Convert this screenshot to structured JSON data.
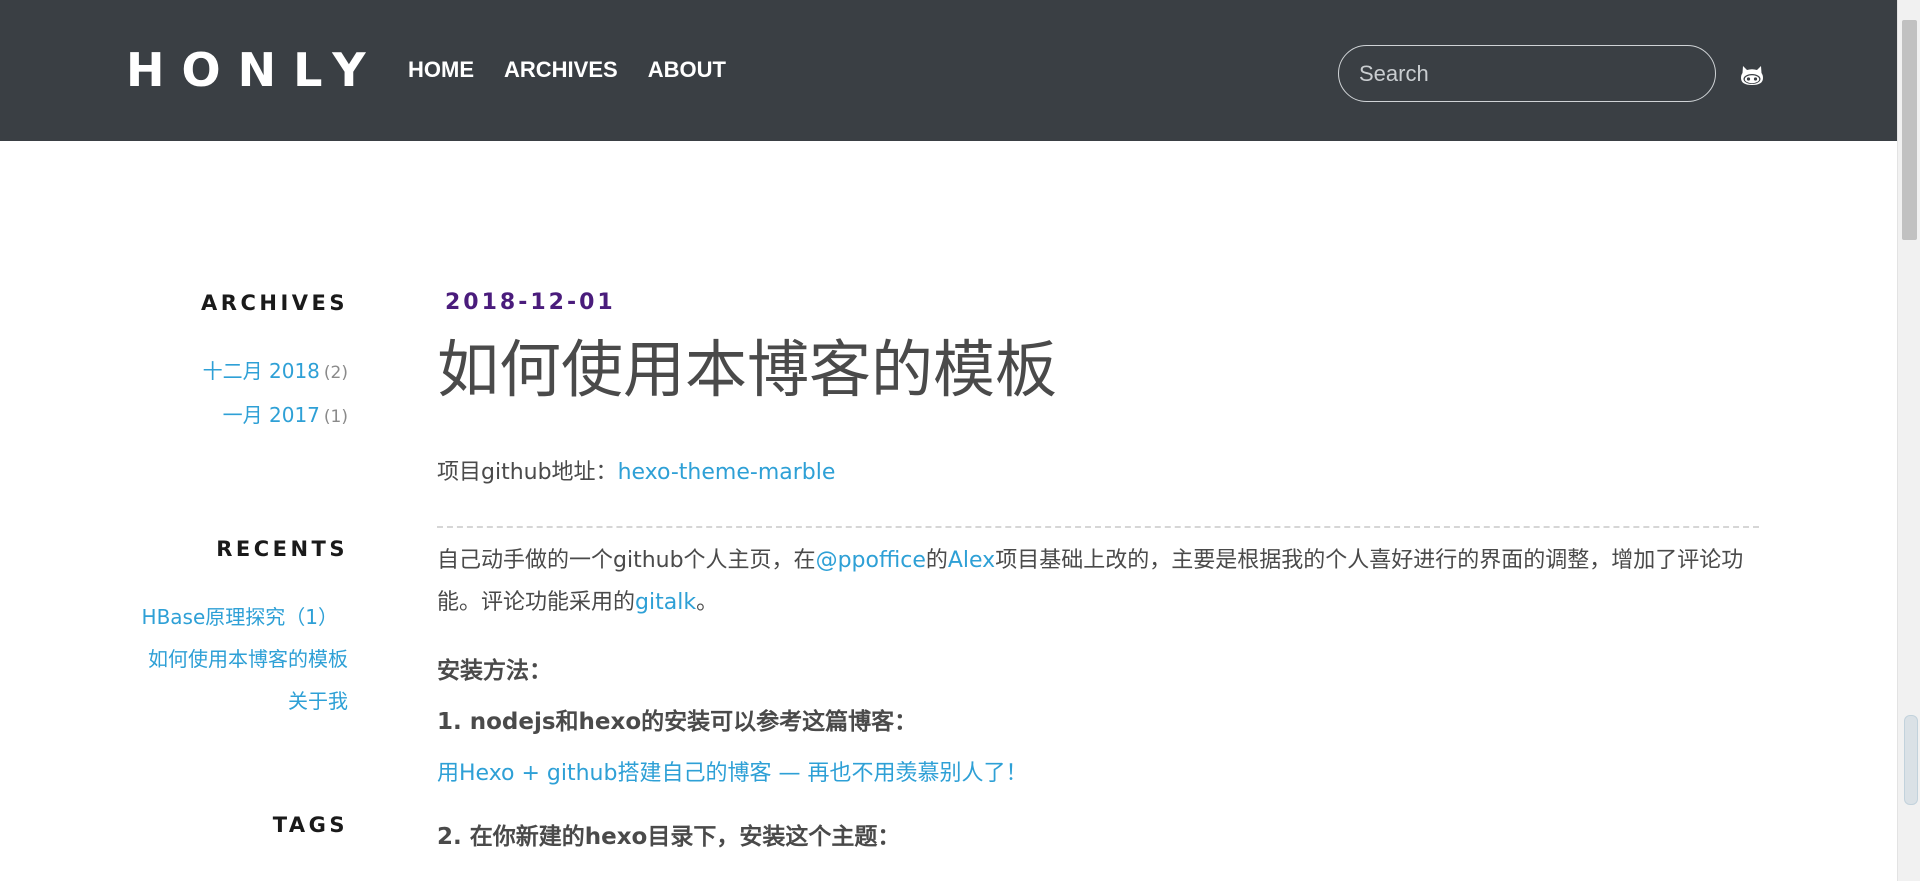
{
  "header": {
    "logo": "HONLY",
    "nav": [
      "HOME",
      "ARCHIVES",
      "ABOUT"
    ],
    "search_placeholder": "Search",
    "github_icon": "octocat-icon"
  },
  "sidebar": {
    "archives": {
      "heading": "ARCHIVES",
      "items": [
        {
          "label": "十二月 2018",
          "count": "(2)"
        },
        {
          "label": "一月 2017",
          "count": "(1)"
        }
      ]
    },
    "recents": {
      "heading": "RECENTS",
      "items": [
        "HBase原理探究（1）",
        "如何使用本博客的模板",
        "关于我"
      ]
    },
    "tags": {
      "heading": "TAGS"
    }
  },
  "post": {
    "date": "2018-12-01",
    "title": "如何使用本博客的模板",
    "repo_prefix": "项目github地址：",
    "repo_link": "hexo-theme-marble",
    "intro": {
      "part1": "自己动手做的一个github个人主页，在",
      "link1": "@ppoffice",
      "part2": "的",
      "link2": "Alex",
      "part3": "项目基础上改的，主要是根据我的个人喜好进行的界面的调整，增加了评论功能。评论功能采用的",
      "link3": "gitalk",
      "part4": "。"
    },
    "install_heading": "安装方法：",
    "step1_heading": "1. nodejs和hexo的安装可以参考这篇博客：",
    "step1_link": "用Hexo + github搭建自己的博客 — 再也不用羡慕别人了！",
    "step2_heading": "2. 在你新建的hexo目录下，安装这个主题："
  },
  "colors": {
    "header_bg": "#3a3f44",
    "link": "#2ea0d6",
    "date": "#4a1c7c",
    "text": "#4a4a4a"
  }
}
